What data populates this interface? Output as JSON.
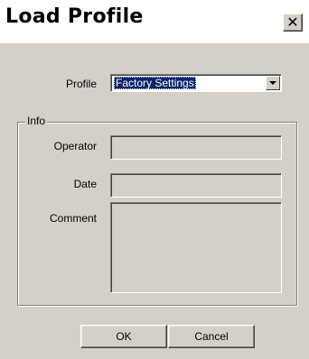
{
  "window": {
    "title": "Load Profile",
    "close_glyph": "✕"
  },
  "profile": {
    "label": "Profile",
    "selected": "Factory Settings"
  },
  "info": {
    "caption": "Info",
    "operator_label": "Operator",
    "operator_value": "",
    "date_label": "Date",
    "date_value": "",
    "comment_label": "Comment",
    "comment_value": ""
  },
  "buttons": {
    "ok": "OK",
    "cancel": "Cancel"
  },
  "icons": {
    "close": "close-icon",
    "dropdown": "chevron-down-icon"
  }
}
